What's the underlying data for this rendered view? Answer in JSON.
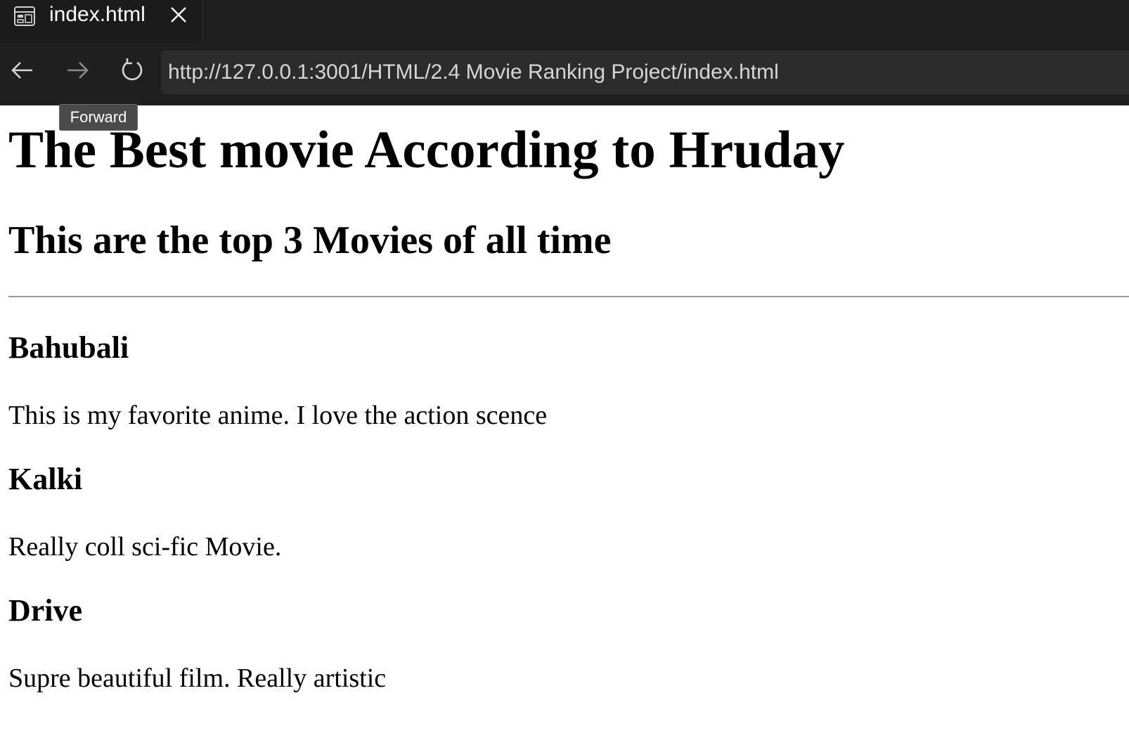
{
  "browser": {
    "tab": {
      "title": "index.html",
      "icon": "preview-icon",
      "close_icon": "close-icon"
    },
    "toolbar": {
      "back_icon": "arrow-left-icon",
      "forward_icon": "arrow-right-icon",
      "reload_icon": "reload-icon",
      "url": "http://127.0.0.1:3001/HTML/2.4 Movie Ranking Project/index.html"
    },
    "tooltip": "Forward"
  },
  "page": {
    "heading": "The Best movie According to Hruday",
    "subheading": "This are the top 3 Movies of all time",
    "movies": [
      {
        "title": "Bahubali",
        "description": "This is my favorite anime. I love the action scence"
      },
      {
        "title": "Kalki",
        "description": "Really coll sci-fic Movie."
      },
      {
        "title": "Drive",
        "description": "Supre beautiful film. Really artistic"
      }
    ]
  },
  "colors": {
    "chrome_bg": "#1f1f1f",
    "address_bg": "#2c2c2c",
    "tooltip_bg": "#4a4a4a",
    "page_bg": "#ffffff",
    "text": "#000000"
  }
}
